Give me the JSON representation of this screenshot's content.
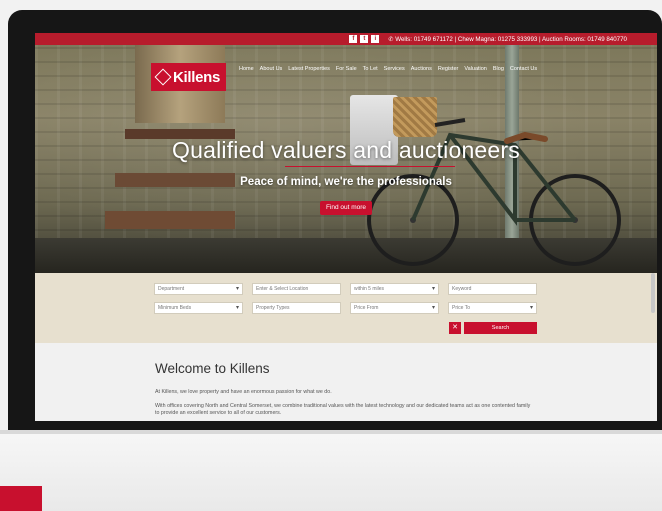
{
  "topbar": {
    "social": [
      "f",
      "t",
      "i"
    ],
    "contacts": [
      {
        "label": "Wells:",
        "value": "01749 671172"
      },
      {
        "label": "Chew Magna:",
        "value": "01275 333993"
      },
      {
        "label": "Auction Rooms:",
        "value": "01749 840770"
      }
    ],
    "contacts_text": "Wells: 01749 671172 | Chew Magna: 01275 333993 | Auction Rooms: 01749 840770"
  },
  "logo": {
    "text": "Killens"
  },
  "nav": [
    "Home",
    "About Us",
    "Latest Properties",
    "For Sale",
    "To Let",
    "Services",
    "Auctions",
    "Register",
    "Valuation",
    "Blog",
    "Contact Us"
  ],
  "hero": {
    "title": "Qualified valuers and auctioneers",
    "subtitle": "Peace of mind, we're the professionals",
    "button": "Find out more"
  },
  "search": {
    "row1": [
      {
        "value": "Department",
        "type": "select"
      },
      {
        "value": "Enter & Select Location",
        "type": "input"
      },
      {
        "value": "within 5 miles",
        "type": "select"
      },
      {
        "value": "Keyword",
        "type": "input"
      }
    ],
    "row2": [
      {
        "value": "Minimum Beds",
        "type": "select"
      },
      {
        "value": "Property Types",
        "type": "input"
      },
      {
        "value": "Price From",
        "type": "select"
      },
      {
        "value": "Price To",
        "type": "select"
      }
    ],
    "clear": "✕",
    "search_button": "Search"
  },
  "welcome": {
    "title": "Welcome to Killens",
    "p1": "At Killens, we love property and have an enormous passion for what we do.",
    "p2": "With offices covering North and Central Somerset, we combine traditional values with the latest technology and our dedicated teams act as one contented family to provide an excellent service to all of our customers."
  },
  "colors": {
    "brand_red": "#c8102e",
    "search_bg": "#e7e0cf"
  }
}
